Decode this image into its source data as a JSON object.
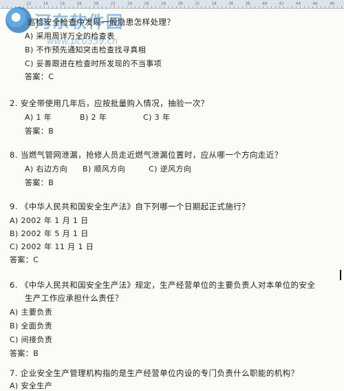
{
  "ruler": {
    "ticks": [
      "12",
      "14",
      "16",
      "18",
      "20",
      "22",
      "24",
      "26",
      "28",
      "30",
      "32",
      "34",
      "36",
      "38",
      "40",
      "42",
      "44",
      "46",
      "48"
    ]
  },
  "watermark": {
    "title": "河东软件园",
    "url": "www.pc0359.cn"
  },
  "q_fragment": {
    "question": "巡检安全检查中发现一般隐患怎样处理？",
    "options": [
      "A) 采用周详万全的检查表",
      "B) 不作预先通知突击检查找寻真相",
      "C) 妥善跟进在检查时所发现的不当事项"
    ],
    "answer": "答案：C"
  },
  "q2": {
    "question": "2. 安全带使用几年后，应按批量购入情况，抽验一次？",
    "options": [
      "A) 1 年",
      "B) 2 年",
      "C) 3 年"
    ],
    "answer": "答案：B"
  },
  "q8": {
    "question": "8. 当燃气管网泄漏，抢修人员走近燃气泄漏位置时，应从哪一个方向走近？",
    "options": [
      "A) 右边方向",
      "B) 顺风方向",
      "C) 逆风方向"
    ],
    "answer": "答案：B"
  },
  "q9": {
    "question": "9. 《中华人民共和国安全生产法》自下列哪一个日期起正式施行？",
    "options": [
      "A)  2002 年 1 月 1 日",
      "B)  2002 年 5 月 1 日",
      "C)  2002 年 11 月 1 日"
    ],
    "answer": "答案：C"
  },
  "q6": {
    "question_line1": "6. 《中华人民共和国安全生产法》规定，生产经营单位的主要负责人对本单位的安全",
    "question_line2": "生产工作应承担什么责任？",
    "options": [
      "A)    主要负责",
      "B)    全面负责",
      "C)    间接负责"
    ],
    "answer": "答案：B"
  },
  "q7": {
    "question": "7. 企业安全生产管理机构指的是生产经营单位内设的专门负责什么职能的机构？",
    "options": [
      "A)    安全生产"
    ]
  }
}
